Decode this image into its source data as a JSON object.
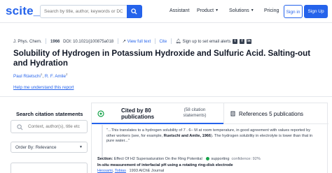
{
  "header": {
    "logo": "scite_",
    "search_placeholder": "Search by title, author, keywords or DOI",
    "nav": [
      "Assistant",
      "Product",
      "Solutions",
      "Pricing"
    ],
    "signin": "Sign in",
    "signup": "Sign Up"
  },
  "article": {
    "journal": "J. Phys. Chem.",
    "year": "1966",
    "doi": "DOI: 10.1021/j100875a018",
    "full_text": "View full text",
    "cite": "Cite",
    "alert": "Sign up to set email alerts",
    "title": "Solubility of Hydrogen in Potassium Hydroxide and Sulfuric Acid. Salting-out and Hydration",
    "authors": [
      {
        "name": "Paul Rüetschi",
        "sup": "1"
      },
      {
        "name": "R. F. Amlie",
        "sup": "2"
      }
    ],
    "help_link": "Help me understand this report"
  },
  "sidebar": {
    "title": "Search citation statements",
    "search_placeholder": "Context, author(s), title etc",
    "order_label": "Order By: Relevance"
  },
  "citations": {
    "cited_by": "Cited by 80 publications",
    "statements": "(58 citation statements)",
    "references": "References 5 publications",
    "snippet_pre": "\"...This translates to a hydrogen solubility of 7 . 6− M at room temperature, in good agreement with values reported by other workers (see, for example,",
    "snippet_bold": "Ruetschi and Amlie, 1966",
    "snippet_post": "). The hydrogen solubility in electrolyte is lower than that in pure water...\"",
    "section_label": "Section:",
    "section_value": "Effect Of H2 Supersaturation On the Ring Potential",
    "support_label": "supporting",
    "confidence": "confidence: 92%",
    "result_title": "In-situ measurement of interfacial pH using a rotating ring-disk electrode",
    "result_author1": "Hessami",
    "result_author2": "Tobias",
    "result_year": "1993 AIChE Journal"
  },
  "colors": {
    "accent": "#2563eb",
    "supporting": "#16a34a"
  }
}
